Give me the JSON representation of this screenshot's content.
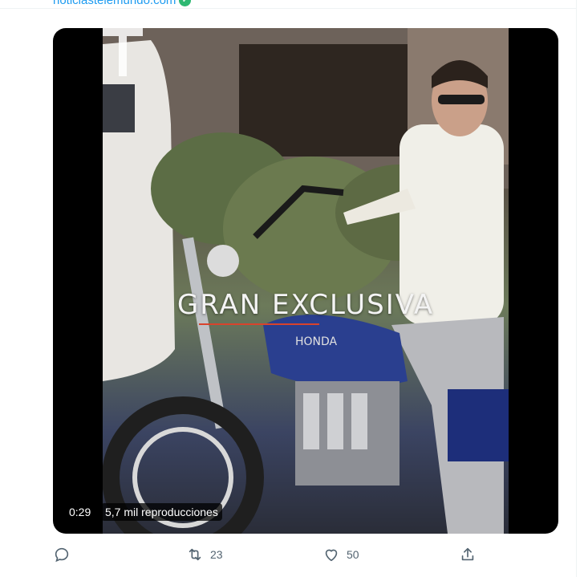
{
  "tweet": {
    "source_link": "noticiastelemundo.com",
    "video": {
      "overlay_title": "GRAN EXCLUSIVA",
      "duration": "0:29",
      "views": "5,7 mil reproducciones"
    },
    "actions": {
      "reply_count": "",
      "retweet_count": "23",
      "like_count": "50"
    }
  },
  "icons": {
    "reply": "reply-icon",
    "retweet": "retweet-icon",
    "like": "heart-icon",
    "share": "share-icon",
    "verified": "verified-icon"
  },
  "colors": {
    "accent": "#1d9bf0",
    "muted": "#536471",
    "verified": "#2eb872"
  }
}
